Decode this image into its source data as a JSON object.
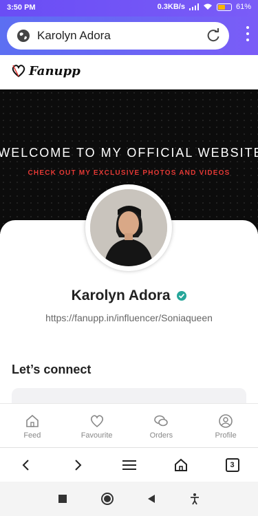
{
  "status": {
    "time": "3:50 PM",
    "speed": "0.3KB/s",
    "battery": "61%",
    "battery_level": 0.61
  },
  "browser": {
    "url_text": "Karolyn Adora",
    "tab_count": "3"
  },
  "site": {
    "logo_text": "Fanupp"
  },
  "banner": {
    "welcome": "WELCOME TO MY OFFICIAL WEBSITE",
    "subtitle": "CHECK OUT MY EXCLUSIVE PHOTOS AND VIDEOS"
  },
  "profile": {
    "name": "Karolyn Adora",
    "link": "https://fanupp.in/influencer/Soniaqueen",
    "section_title": "Let’s connect"
  },
  "nav": {
    "items": [
      {
        "label": "Feed",
        "icon": "home-icon"
      },
      {
        "label": "Favourite",
        "icon": "heart-icon"
      },
      {
        "label": "Orders",
        "icon": "chat-icon"
      },
      {
        "label": "Profile",
        "icon": "profile-icon"
      }
    ]
  },
  "colors": {
    "accent": "#7a5cf7",
    "verify": "#26a69a",
    "banner_red": "#e53935"
  }
}
